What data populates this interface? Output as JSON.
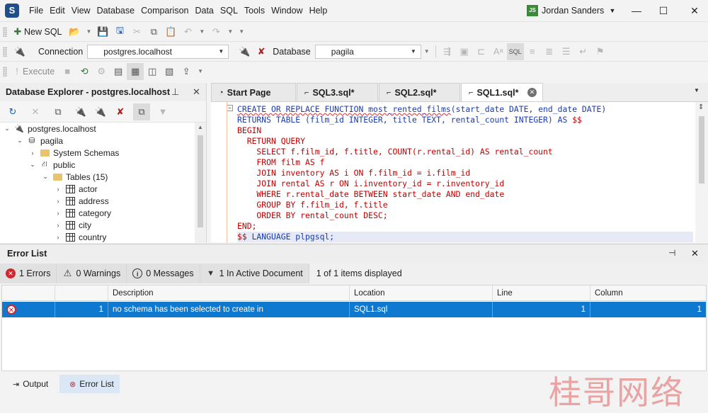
{
  "titlebar": {
    "menu": [
      "File",
      "Edit",
      "View",
      "Database",
      "Comparison",
      "Data",
      "SQL",
      "Tools",
      "Window",
      "Help"
    ],
    "user_initials": "JS",
    "user_name": "Jordan Sanders"
  },
  "toolbar1": {
    "new_sql": "New SQL"
  },
  "toolbar2": {
    "connection_label": "Connection",
    "connection_value": "postgres.localhost",
    "database_label": "Database",
    "database_value": "pagila"
  },
  "toolbar3": {
    "execute": "Execute"
  },
  "db_explorer": {
    "title": "Database Explorer - postgres.localhost",
    "tree": [
      {
        "label": "postgres.localhost"
      },
      {
        "label": "pagila"
      },
      {
        "label": "System Schemas"
      },
      {
        "label": "public"
      },
      {
        "label": "Tables (15)"
      },
      {
        "label": "actor"
      },
      {
        "label": "address"
      },
      {
        "label": "category"
      },
      {
        "label": "city"
      },
      {
        "label": "country"
      }
    ]
  },
  "editor": {
    "tabs": [
      "Start Page",
      "SQL3.sql*",
      "SQL2.sql*",
      "SQL1.sql*"
    ],
    "active_tab": "SQL1.sql*"
  },
  "error_list": {
    "title": "Error List",
    "errors_btn": "1 Errors",
    "warnings_btn": "0 Warnings",
    "messages_btn": "0 Messages",
    "active_doc_btn": "1 In Active Document",
    "items_displayed": "1 of 1 items displayed",
    "columns": [
      "Description",
      "Location",
      "Line",
      "Column"
    ],
    "rows": [
      {
        "num": "1",
        "description": "no schema has been selected to create in",
        "location": "SQL1.sql",
        "line": "1",
        "column": "1"
      }
    ]
  },
  "bottom_tabs": {
    "output": "Output",
    "error_list": "Error List"
  },
  "watermark": "桂哥网络",
  "colors": {
    "selection": "#0f79d0",
    "error": "#d0262e",
    "keyword": "#1a3bb0",
    "string": "#c00000"
  }
}
